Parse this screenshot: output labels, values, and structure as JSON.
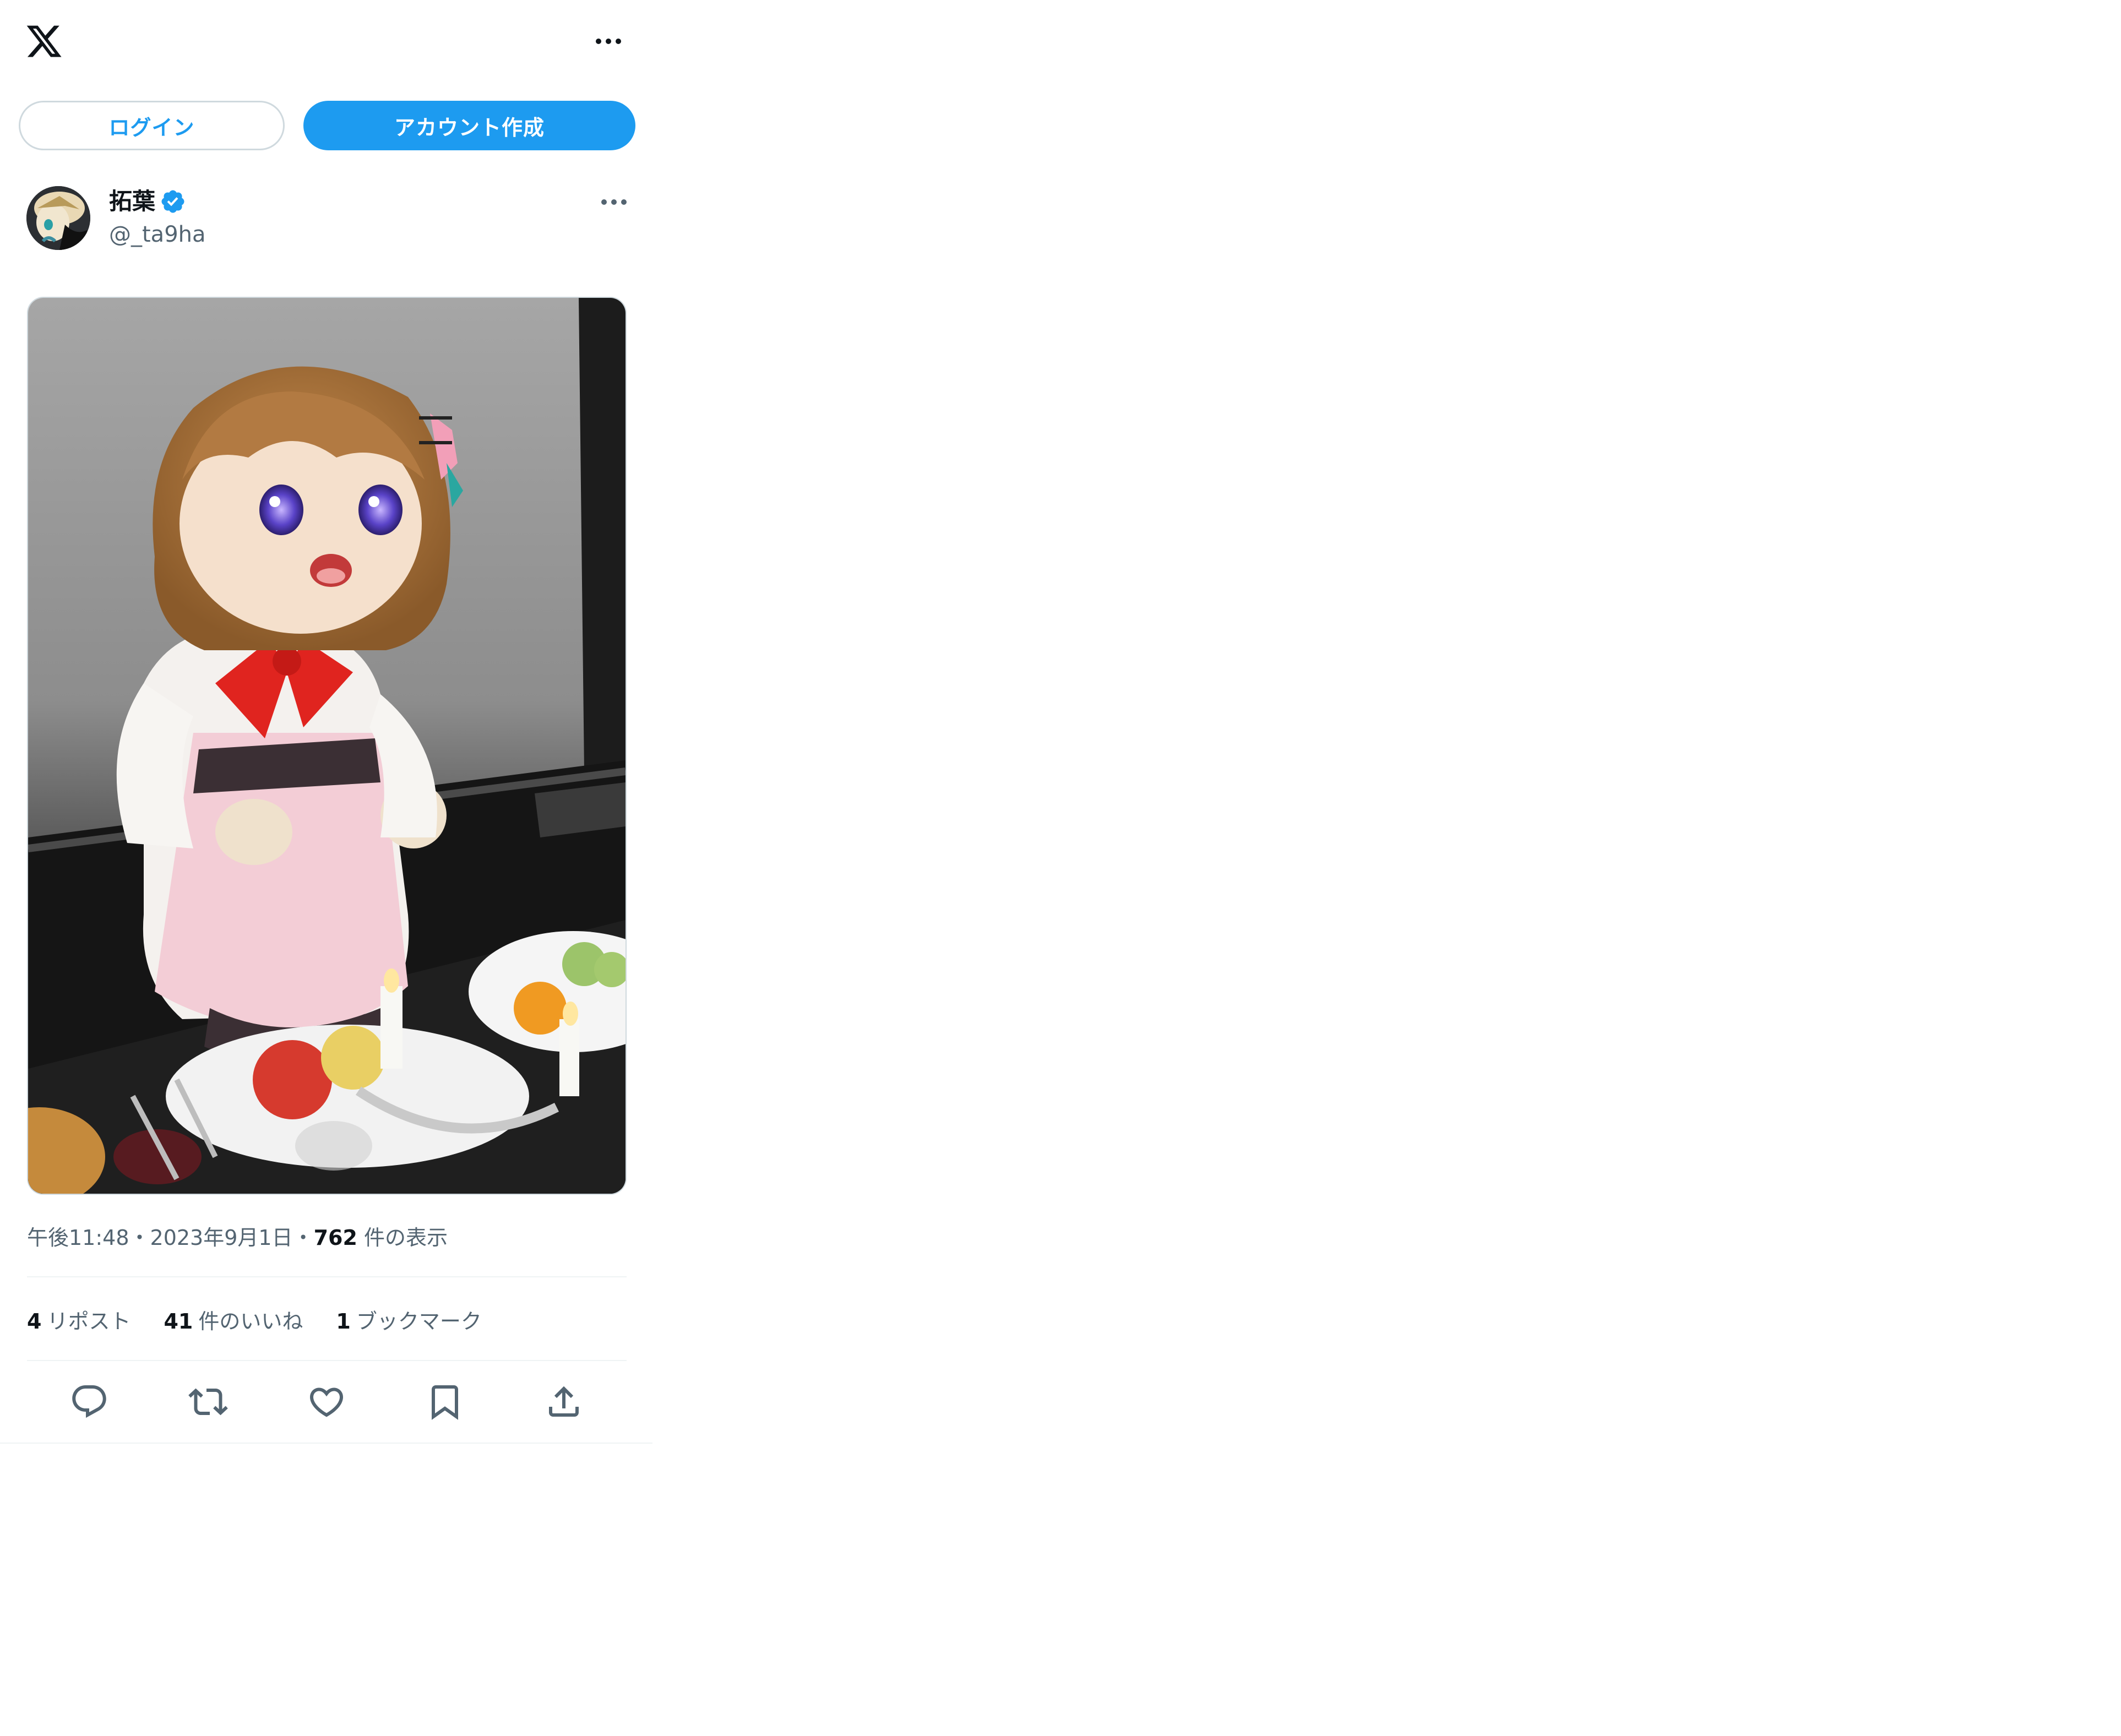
{
  "topbar": {
    "logo_icon": "x-logo-icon",
    "more_icon": "more-horizontal-icon"
  },
  "auth": {
    "login_label": "ログイン",
    "signup_label": "アカウント作成"
  },
  "post": {
    "author": {
      "name": "拓葉",
      "handle": "@_ta9ha",
      "verified": true
    },
    "time": "午後11:48",
    "sep1": "・",
    "date": "2023年9月1日",
    "sep2": "・",
    "views_count": "762",
    "views_label": "件の表示",
    "stats": {
      "reposts_count": "4",
      "reposts_label": "リポスト",
      "likes_count": "41",
      "likes_label": "件のいいね",
      "bookmarks_count": "1",
      "bookmarks_label": "ブックマーク"
    },
    "actions": [
      "reply-icon",
      "repost-icon",
      "like-icon",
      "bookmark-icon",
      "share-icon"
    ]
  },
  "colors": {
    "accent": "#1d9bf0",
    "text": "#0f1419",
    "secondary": "#536471",
    "border": "#cfd9de"
  }
}
